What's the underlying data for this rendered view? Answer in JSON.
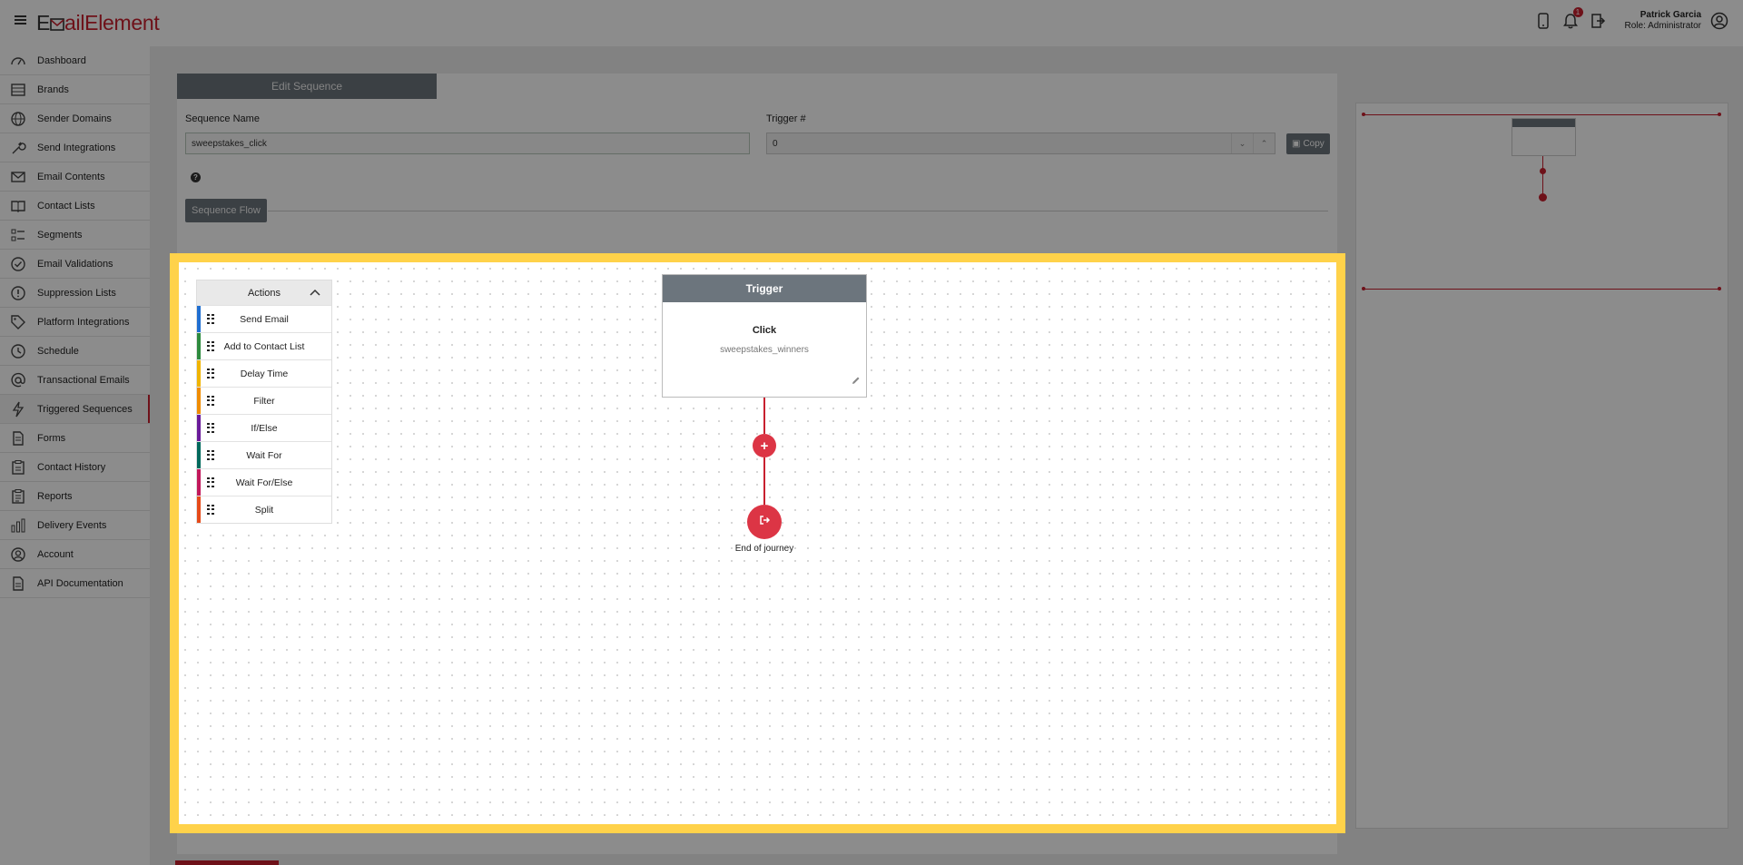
{
  "app": {
    "logo_part1": "E",
    "logo_part2": "ailElement",
    "notification_count": "1",
    "user_name": "Patrick Garcia",
    "user_role": "Role: Administrator"
  },
  "sidebar": {
    "items": [
      {
        "label": "Dashboard",
        "icon": "dashboard-gauge-icon"
      },
      {
        "label": "Brands",
        "icon": "brands-list-icon"
      },
      {
        "label": "Sender Domains",
        "icon": "globe-icon"
      },
      {
        "label": "Send Integrations",
        "icon": "wrench-icon"
      },
      {
        "label": "Email Contents",
        "icon": "envelope-icon"
      },
      {
        "label": "Contact Lists",
        "icon": "book-icon"
      },
      {
        "label": "Segments",
        "icon": "segments-list-icon"
      },
      {
        "label": "Email Validations",
        "icon": "check-circle-icon"
      },
      {
        "label": "Suppression Lists",
        "icon": "exclamation-circle-icon"
      },
      {
        "label": "Platform Integrations",
        "icon": "tag-icon"
      },
      {
        "label": "Schedule",
        "icon": "clock-icon"
      },
      {
        "label": "Transactional Emails",
        "icon": "at-sign-icon"
      },
      {
        "label": "Triggered Sequences",
        "icon": "lightning-icon"
      },
      {
        "label": "Forms",
        "icon": "document-icon"
      },
      {
        "label": "Contact History",
        "icon": "clipboard-icon"
      },
      {
        "label": "Reports",
        "icon": "clipboard-report-icon"
      },
      {
        "label": "Delivery Events",
        "icon": "bar-chart-icon"
      },
      {
        "label": "Account",
        "icon": "user-circle-icon"
      },
      {
        "label": "API Documentation",
        "icon": "api-document-icon"
      }
    ],
    "active_index": 12
  },
  "edit": {
    "tab_label": "Edit Sequence",
    "name_label": "Sequence Name",
    "name_value": "sweepstakes_click",
    "trigger_label": "Trigger #",
    "trigger_value": "0",
    "copy_label": "Copy",
    "help_glyph": "?",
    "flow_label": "Sequence Flow"
  },
  "canvas": {
    "actions_title": "Actions",
    "actions": [
      {
        "label": "Send Email",
        "color": "#1f6fd1"
      },
      {
        "label": "Add to Contact List",
        "color": "#2e8b3e"
      },
      {
        "label": "Delay Time",
        "color": "#f0b400"
      },
      {
        "label": "Filter",
        "color": "#f08c00"
      },
      {
        "label": "If/Else",
        "color": "#6a1b9a"
      },
      {
        "label": "Wait For",
        "color": "#00695c"
      },
      {
        "label": "Wait For/Else",
        "color": "#c2185b"
      },
      {
        "label": "Split",
        "color": "#e64a19"
      }
    ],
    "trigger_title": "Trigger",
    "trigger_type": "Click",
    "trigger_value": "sweepstakes_winners",
    "add_glyph": "+",
    "end_label": "End of journey"
  },
  "colors": {
    "brand": "#c8202f",
    "highlight": "#ffd24a",
    "node": "#dc3545",
    "tab_gray": "#6c757d"
  }
}
